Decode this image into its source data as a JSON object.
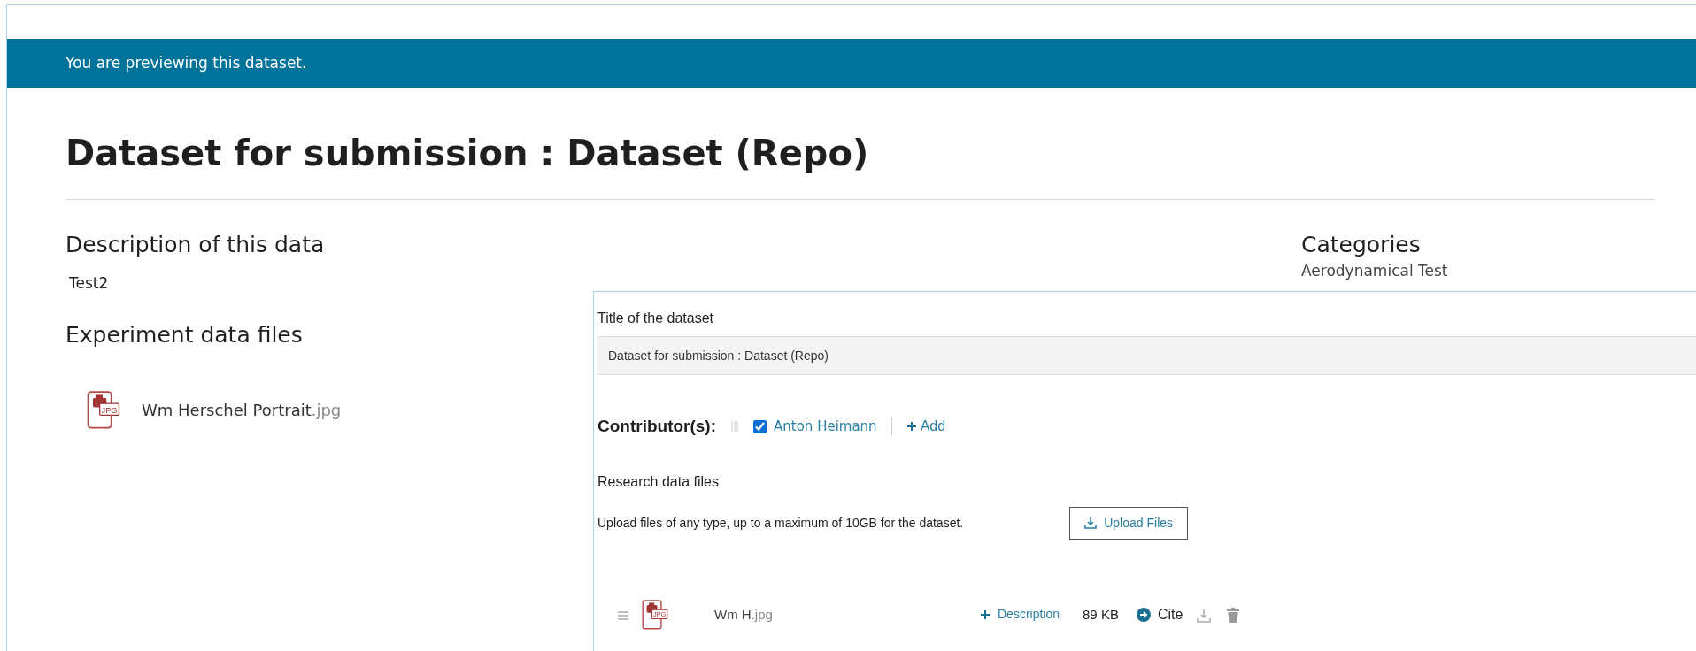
{
  "banner": {
    "text": "You are previewing this dataset."
  },
  "page": {
    "title": "Dataset for submission : Dataset (Repo)",
    "description_heading": "Description of this data",
    "description": "Test2",
    "files_heading": "Experiment data files",
    "files": [
      {
        "name": "Wm Herschel Portrait",
        "extension": ".jpg",
        "type_label": "JPG"
      }
    ],
    "categories_heading": "Categories",
    "categories": [
      "Aerodynamical Test"
    ]
  },
  "editor": {
    "title_label": "Title of the dataset",
    "title_value": "Dataset for submission : Dataset (Repo)",
    "contributors_label": "Contributor(s):",
    "contributors": [
      {
        "name": "Anton Heimann",
        "checked": true
      }
    ],
    "add_label": "Add",
    "files_label": "Research data files",
    "upload_hint": "Upload files of any type, up to a maximum of 10GB for the dataset.",
    "upload_button": "Upload Files",
    "files": [
      {
        "name": "Wm H",
        "extension": ".jpg",
        "type_label": "JPG",
        "description_button": "Description",
        "size": "89 KB",
        "cite": "Cite"
      }
    ]
  }
}
